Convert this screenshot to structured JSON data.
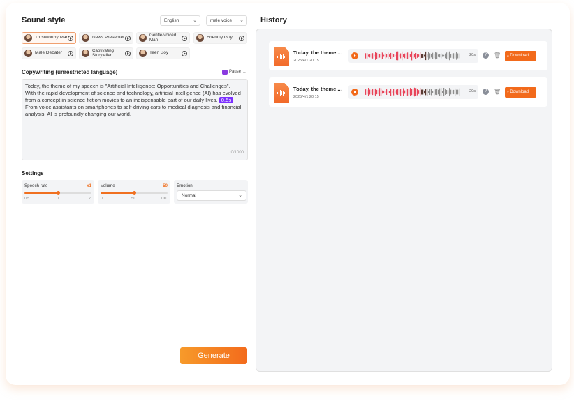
{
  "sound_style": {
    "title": "Sound style",
    "language": "English",
    "voice_type": "male voice",
    "voices": [
      {
        "label": "Trustworthy Man",
        "selected": true
      },
      {
        "label": "News Presenter",
        "selected": false
      },
      {
        "label": "Gentle-voiced Man",
        "selected": false
      },
      {
        "label": "Friendly Guy",
        "selected": false
      },
      {
        "label": "Male Debater",
        "selected": false
      },
      {
        "label": "Captivating Storyteller",
        "selected": false
      },
      {
        "label": "Teen Boy",
        "selected": false
      }
    ]
  },
  "copywriting": {
    "title": "Copywriting (unrestricted language)",
    "pause_label": "Pause",
    "text_part1": "Today, the theme of my speech is \"Artificial Intelligence: Opportunities and Challenges\".",
    "text_part2": "With the rapid development of science and technology, artificial intelligence (AI) has evolved from a concept in science fiction movies to an indispensable part of our daily lives.",
    "pause_tag": "0.5s",
    "text_part3": "From voice assistants on smartphones to self-driving cars to medical diagnosis and financial analysis, AI is profoundly changing our world.",
    "counter": "0/1000"
  },
  "settings": {
    "title": "Settings",
    "speech_rate": {
      "label": "Speech rate",
      "value": "x1",
      "level": 0.5,
      "ticks": [
        "0.5",
        "1",
        "2"
      ]
    },
    "volume": {
      "label": "Volume",
      "value": "50",
      "level": 0.5,
      "ticks": [
        "0",
        "50",
        "100"
      ]
    },
    "emotion": {
      "label": "Emotion",
      "value": "Normal"
    }
  },
  "generate_label": "Generate",
  "history": {
    "title": "History",
    "items": [
      {
        "title": "Today, the theme ...",
        "date": "2025/4/1 20:15",
        "duration": "20s",
        "state": "play",
        "download": "Download"
      },
      {
        "title": "Today, the theme ...",
        "date": "2025/4/1 20:15",
        "duration": "20s",
        "state": "pause",
        "download": "Download"
      }
    ]
  },
  "colors": {
    "accent": "#f26a1b",
    "pause_tag": "#7b2fff",
    "played_wave": "#e8455a",
    "unplayed_wave": "#8f8f8f"
  },
  "icons": [
    "play-icon",
    "pause-icon",
    "help-icon",
    "trash-icon",
    "download-icon",
    "chevron-down-icon",
    "audio-file-icon"
  ]
}
